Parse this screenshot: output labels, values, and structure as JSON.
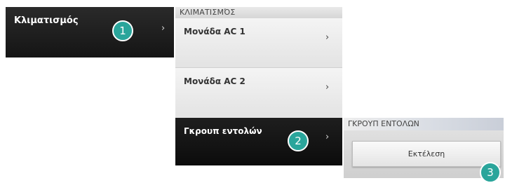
{
  "main_menu": {
    "item_label": "Κλιματισμός",
    "chevron": "›"
  },
  "submenu": {
    "header": "ΚΛΙΜΑΤΙΣΜΌΣ",
    "items": [
      {
        "label": "Μονάδα AC 1",
        "chevron": "›"
      },
      {
        "label": "Μονάδα AC 2",
        "chevron": "›"
      },
      {
        "label": "Γκρουπ εντολών",
        "chevron": "›"
      }
    ]
  },
  "group_panel": {
    "header": "ΓΚΡΟΥΠ ΕΝΤΟΛΩΝ",
    "execute_label": "Εκτέλεση"
  },
  "callouts": [
    "1",
    "2",
    "3"
  ],
  "colors": {
    "callout": "#2aa59b",
    "dark_item": "#151515"
  }
}
